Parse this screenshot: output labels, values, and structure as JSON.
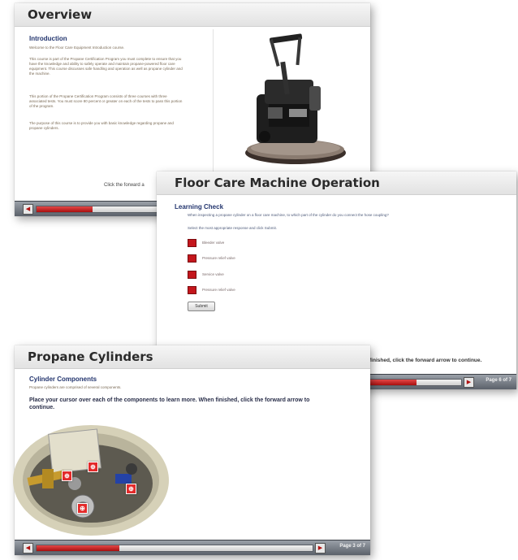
{
  "overview": {
    "title": "Overview",
    "section_heading": "Introduction",
    "para1": "Welcome to the Floor Care Equipment Introduction course.",
    "para2": "This course is part of the Propane Certification Program you must complete to ensure that you have the knowledge and ability to safely operate and maintain propane-powered floor care equipment. This course discusses safe handling and operation as well as propane cylinder and the machine.",
    "para3": "This portion of the Propane Certification Program consists of three courses with three associated tests. You must score 80 percent or greater on each of the tests to pass this portion of the program.",
    "para4": "The purpose of this course is to provide you with basic knowledge regarding propane and propane cylinders.",
    "footer_text": "Click the forward a",
    "progress": 0.42
  },
  "floorcare": {
    "title": "Floor Care Machine Operation",
    "section_heading": "Learning Check",
    "question": "When inspecting a propane cylinder on a floor care machine, to which part of the cylinder do you connect the hose coupling?",
    "instruction": "Select the most appropriate response and click Submit.",
    "options": [
      "Bleeder valve",
      "Pressure relief valve",
      "Service valve",
      "Pressure relief valve"
    ],
    "submit_label": "Submit",
    "footer_text": "finished, click the forward arrow to continue.",
    "page_label": "Page 6 of 7",
    "progress": 0.55
  },
  "propane": {
    "title": "Propane Cylinders",
    "section_heading": "Cylinder Components",
    "subtext": "Propane cylinders are comprised of several components.",
    "instruction": "Place your cursor over each of the components to learn more. When finished, click the forward arrow to continue.",
    "page_label": "Page 3 of 7",
    "progress": 0.3
  }
}
